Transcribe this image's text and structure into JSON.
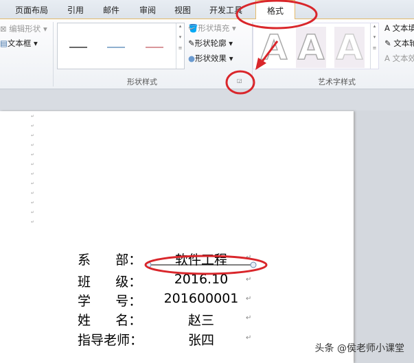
{
  "tabs": [
    "页面布局",
    "引用",
    "邮件",
    "审阅",
    "视图",
    "开发工具",
    "格式"
  ],
  "ribbon": {
    "insert_shapes": {
      "edit_shape": "编辑形状",
      "textbox": "文本框"
    },
    "shape_styles": {
      "label": "形状样式",
      "fill": "形状填充",
      "outline": "形状轮廓",
      "effects": "形状效果"
    },
    "wordart_styles": {
      "label": "艺术字样式",
      "sample": "A",
      "text_fill": "文本填充",
      "text_outline": "文本轮廓",
      "text_effects": "文本效果"
    }
  },
  "document": {
    "rows": [
      {
        "label": "系      部：",
        "value": "软件工程"
      },
      {
        "label": "班      级：",
        "value": "2016.10"
      },
      {
        "label": "学      号：",
        "value": "201600001"
      },
      {
        "label": "姓      名：",
        "value": "赵三"
      },
      {
        "label": "指导老师：",
        "value": "张四"
      }
    ]
  },
  "watermark": "头条 @侯老师小课堂",
  "colors": {
    "annotation": "#d9262b"
  }
}
